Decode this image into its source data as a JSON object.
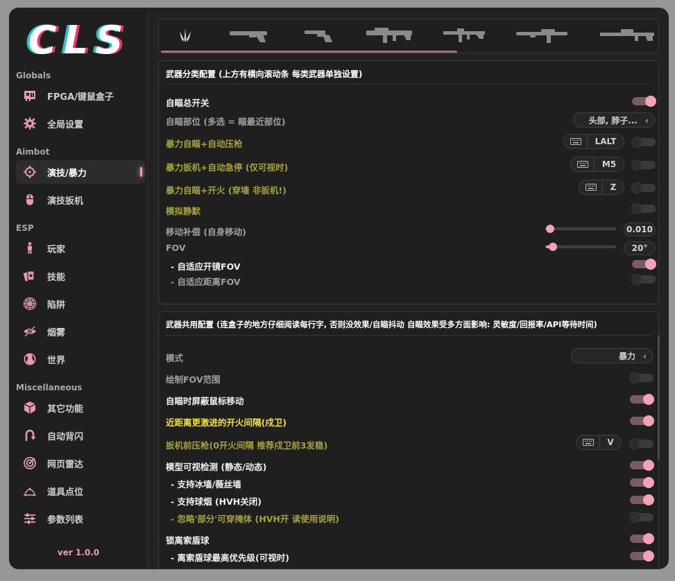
{
  "app": {
    "logo": "CLS",
    "version": "ver 1.0.0",
    "accent": "#efa3b4"
  },
  "sidebar": {
    "sections": [
      {
        "label": "Globals"
      },
      {
        "label": "Aimbot"
      },
      {
        "label": "ESP"
      },
      {
        "label": "Miscellaneous"
      }
    ],
    "items": [
      {
        "label": "FPGA/键鼠盒子",
        "icon": "hardware-card-icon"
      },
      {
        "label": "全局设置",
        "icon": "gear-icon"
      },
      {
        "label": "演技/暴力",
        "icon": "crosshair-icon",
        "active": true
      },
      {
        "label": "演技扳机",
        "icon": "mouse-icon"
      },
      {
        "label": "玩家",
        "icon": "person-icon"
      },
      {
        "label": "技能",
        "icon": "cards-icon"
      },
      {
        "label": "陷阱",
        "icon": "spiderweb-icon"
      },
      {
        "label": "烟雾",
        "icon": "eye-slash-icon"
      },
      {
        "label": "世界",
        "icon": "globe-icon"
      },
      {
        "label": "其它功能",
        "icon": "cube-icon"
      },
      {
        "label": "自动背闪",
        "icon": "u-turn-icon"
      },
      {
        "label": "网页雷达",
        "icon": "radar-icon"
      },
      {
        "label": "道具点位",
        "icon": "waypoint-icon"
      },
      {
        "label": "参数列表",
        "icon": "sliders-icon"
      }
    ]
  },
  "weapon_tabs": [
    {
      "icon": "claw-icon"
    },
    {
      "icon": "pistol-icon"
    },
    {
      "icon": "revolver-icon"
    },
    {
      "icon": "smg-icon"
    },
    {
      "icon": "rifle-icon"
    },
    {
      "icon": "shotgun-icon"
    },
    {
      "icon": "sniper-icon"
    }
  ],
  "panel1": {
    "title": "武器分类配置 (上方有横向滚动条 每类武器单独设置)",
    "rows": {
      "aim_master": "自瞄总开关",
      "aim_parts": "自瞄部位 (多选 = 瞄最近部位)",
      "aim_parts_value": "头部, 脖子...",
      "brute_aim": "暴力自瞄+自动压枪",
      "brute_aim_key": "LALT",
      "brute_trigger": "暴力扳机+自动急停 (仅可视时)",
      "brute_trigger_key": "M5",
      "brute_fire": "暴力自瞄+开火 (穿墙 非扳机!)",
      "brute_fire_key": "Z",
      "silent": "模拟静默",
      "move_comp": "移动补偿 (自身移动)",
      "move_comp_value": "0.010",
      "fov": "FOV",
      "fov_value": "20°",
      "adaptive_scope": "- 自适应开镜FOV",
      "adaptive_dist": "- 自适应距离FOV"
    },
    "sliders": {
      "move_comp": 0.0,
      "fov": 0.04
    }
  },
  "panel2": {
    "title": "武器共用配置 (连盒子的地方仔细阅读每行字, 否则没效果/自瞄抖动  自瞄效果受多方面影响: 灵敏度/回报率/API等待时间)",
    "rows": {
      "mode": "模式",
      "mode_value": "暴力",
      "draw_fov": "绘制FOV范围",
      "block_mouse": "自瞄时屏蔽鼠标移动",
      "close_range": "近距离更激进的开火间隔(戍卫)",
      "pre_trigger": "扳机前压枪(0开火间隔 推荐戍卫前3发稳)",
      "pre_trigger_key": "V",
      "vis_check": "模型可视检测 (静态/动态)",
      "ice_wall": "- 支持冰墙/薇丝墙",
      "smoke": "- 支持球烟 (HVH关闭)",
      "ignore_cover": "- 忽略'部分'可穿掩体 (HVH开 读使用说明)",
      "lock_orb": "锁离索盾球",
      "orb_priority": "- 离索盾球最高优先级(可视时)"
    }
  },
  "toggles": {
    "aim_master": true,
    "brute_aim": false,
    "brute_trigger": false,
    "brute_fire": false,
    "silent": false,
    "adaptive_scope": true,
    "adaptive_dist": false,
    "draw_fov": false,
    "block_mouse": true,
    "close_range": true,
    "pre_trigger": false,
    "vis_check": true,
    "ice_wall": true,
    "smoke": true,
    "ignore_cover": false,
    "lock_orb": true,
    "orb_priority": true
  }
}
